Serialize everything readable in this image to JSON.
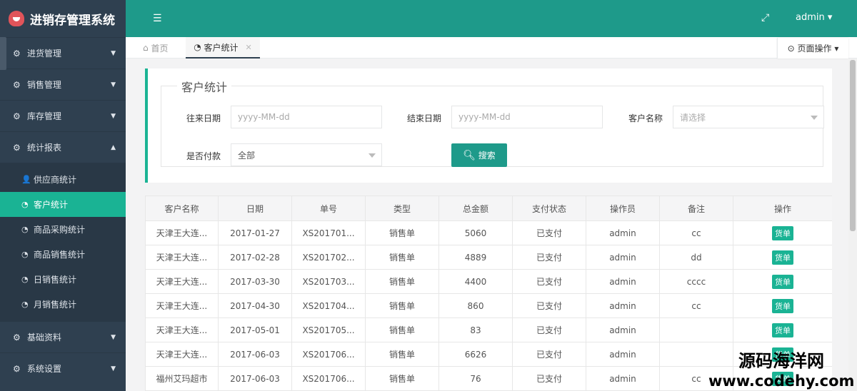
{
  "app": {
    "title": "进销存管理系统"
  },
  "sidebar": {
    "menus": [
      {
        "label": "进货管理"
      },
      {
        "label": "销售管理"
      },
      {
        "label": "库存管理"
      },
      {
        "label": "统计报表",
        "expanded": true
      },
      {
        "label": "基础资料"
      },
      {
        "label": "系统设置"
      }
    ],
    "submenu": [
      {
        "label": "供应商统计",
        "icon": "user-icon"
      },
      {
        "label": "客户统计",
        "icon": "dashboard-icon",
        "active": true
      },
      {
        "label": "商品采购统计",
        "icon": "dashboard-icon"
      },
      {
        "label": "商品销售统计",
        "icon": "dashboard-icon"
      },
      {
        "label": "日销售统计",
        "icon": "dashboard-icon"
      },
      {
        "label": "月销售统计",
        "icon": "dashboard-icon"
      }
    ]
  },
  "header": {
    "user": "admin"
  },
  "tabs": {
    "home": "首页",
    "current": "客户统计",
    "page_op": "页面操作"
  },
  "filter": {
    "legend": "客户统计",
    "start_label": "往来日期",
    "start_placeholder": "yyyy-MM-dd",
    "end_label": "结束日期",
    "end_placeholder": "yyyy-MM-dd",
    "customer_label": "客户名称",
    "customer_value": "请选择",
    "paid_label": "是否付款",
    "paid_value": "全部",
    "search_label": "搜索"
  },
  "table": {
    "headers": [
      "客户名称",
      "日期",
      "单号",
      "类型",
      "总金额",
      "支付状态",
      "操作员",
      "备注",
      "操作"
    ],
    "rows": [
      [
        "天津王大连...",
        "2017-01-27",
        "XS201701...",
        "销售单",
        "5060",
        "已支付",
        "admin",
        "cc",
        "货单"
      ],
      [
        "天津王大连...",
        "2017-02-28",
        "XS201702...",
        "销售单",
        "4889",
        "已支付",
        "admin",
        "dd",
        "货单"
      ],
      [
        "天津王大连...",
        "2017-03-30",
        "XS201703...",
        "销售单",
        "4400",
        "已支付",
        "admin",
        "cccc",
        "货单"
      ],
      [
        "天津王大连...",
        "2017-04-30",
        "XS201704...",
        "销售单",
        "860",
        "已支付",
        "admin",
        "cc",
        "货单"
      ],
      [
        "天津王大连...",
        "2017-05-01",
        "XS201705...",
        "销售单",
        "83",
        "已支付",
        "admin",
        "",
        "货单"
      ],
      [
        "天津王大连...",
        "2017-06-03",
        "XS201706...",
        "销售单",
        "6626",
        "已支付",
        "admin",
        "",
        "货单"
      ],
      [
        "福州艾玛超市",
        "2017-06-03",
        "XS201706...",
        "销售单",
        "76",
        "已支付",
        "admin",
        "cc",
        "货单"
      ]
    ]
  },
  "watermark": {
    "line1": "源码海洋网",
    "line2": "www.codehy.com"
  },
  "colors": {
    "sidebar": "#2f4050",
    "accent": "#1ab394",
    "header": "#1e9a8a"
  }
}
